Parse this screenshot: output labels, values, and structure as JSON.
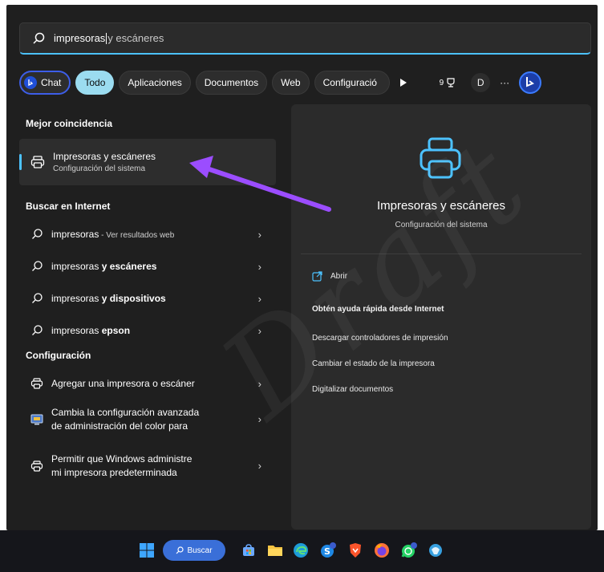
{
  "search": {
    "typed": "impresoras",
    "rest": "y escáneres"
  },
  "filters": {
    "chat": "Chat",
    "todo": "Todo",
    "apps": "Aplicaciones",
    "docs": "Documentos",
    "web": "Web",
    "config": "Configuració",
    "count": "9",
    "avatar": "D",
    "more": "···"
  },
  "left": {
    "best_match_title": "Mejor coincidencia",
    "best": {
      "title": "Impresoras y escáneres",
      "subtitle": "Configuración del sistema"
    },
    "web_title": "Buscar en Internet",
    "web_items": [
      {
        "base": "impresoras",
        "bold": "",
        "suffix": " - Ver resultados web"
      },
      {
        "base": "impresoras ",
        "bold": "y escáneres",
        "suffix": ""
      },
      {
        "base": "impresoras ",
        "bold": "y dispositivos",
        "suffix": ""
      },
      {
        "base": "impresoras ",
        "bold": "epson",
        "suffix": ""
      }
    ],
    "config_title": "Configuración",
    "config_items": [
      {
        "line1": "Agregar una impresora o escáner",
        "line2": ""
      },
      {
        "line1": "Cambia la configuración avanzada",
        "line2": "de administración del color para"
      },
      {
        "line1": "Permitir que Windows administre",
        "line2": "mi impresora predeterminada"
      }
    ]
  },
  "right": {
    "title": "Impresoras y escáneres",
    "subtitle": "Configuración del sistema",
    "open": "Abrir",
    "quick_help": "Obtén ayuda rápida desde Internet",
    "actions": [
      "Descargar controladores de impresión",
      "Cambiar el estado de la impresora",
      "Digitalizar documentos"
    ]
  },
  "taskbar": {
    "search_label": "Buscar"
  },
  "watermark": "Draft",
  "colors": {
    "accent": "#4cc2ff",
    "active_pill": "#9bdcf0",
    "arrow": "#9b4dff",
    "panel_bg": "#1f1f1f"
  }
}
